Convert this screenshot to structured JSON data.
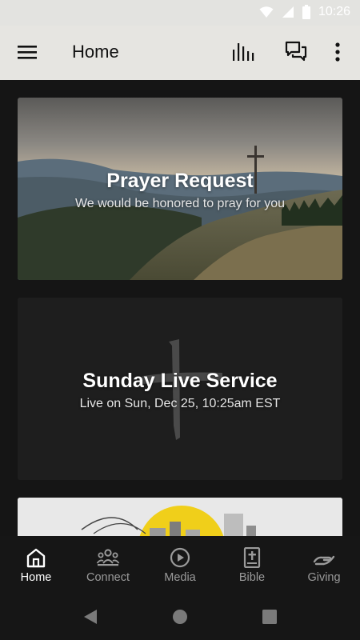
{
  "status_bar": {
    "time": "10:26",
    "icons": [
      "wifi-icon",
      "cellular-signal-icon",
      "battery-icon"
    ]
  },
  "app_bar": {
    "title": "Home",
    "actions": [
      "menu-icon",
      "audio-bars-icon",
      "chat-bubbles-icon",
      "more-vertical-icon"
    ]
  },
  "cards": [
    {
      "title": "Prayer Request",
      "subtitle": "We would be honored to pray for you"
    },
    {
      "title": "Sunday Live Service",
      "subtitle": "Live on Sun, Dec 25, 10:25am EST"
    }
  ],
  "bottom_nav": {
    "items": [
      {
        "label": "Home",
        "icon": "home-icon",
        "active": true
      },
      {
        "label": "Connect",
        "icon": "people-group-icon",
        "active": false
      },
      {
        "label": "Media",
        "icon": "play-circle-icon",
        "active": false
      },
      {
        "label": "Bible",
        "icon": "bible-icon",
        "active": false
      },
      {
        "label": "Giving",
        "icon": "giving-hand-icon",
        "active": false
      }
    ]
  },
  "colors": {
    "app_bar_bg": "#e6e5e1",
    "screen_bg": "#161616",
    "card_bg": "#1f1f1f",
    "active_nav": "#ffffff",
    "inactive_nav": "#9a9a9a"
  }
}
